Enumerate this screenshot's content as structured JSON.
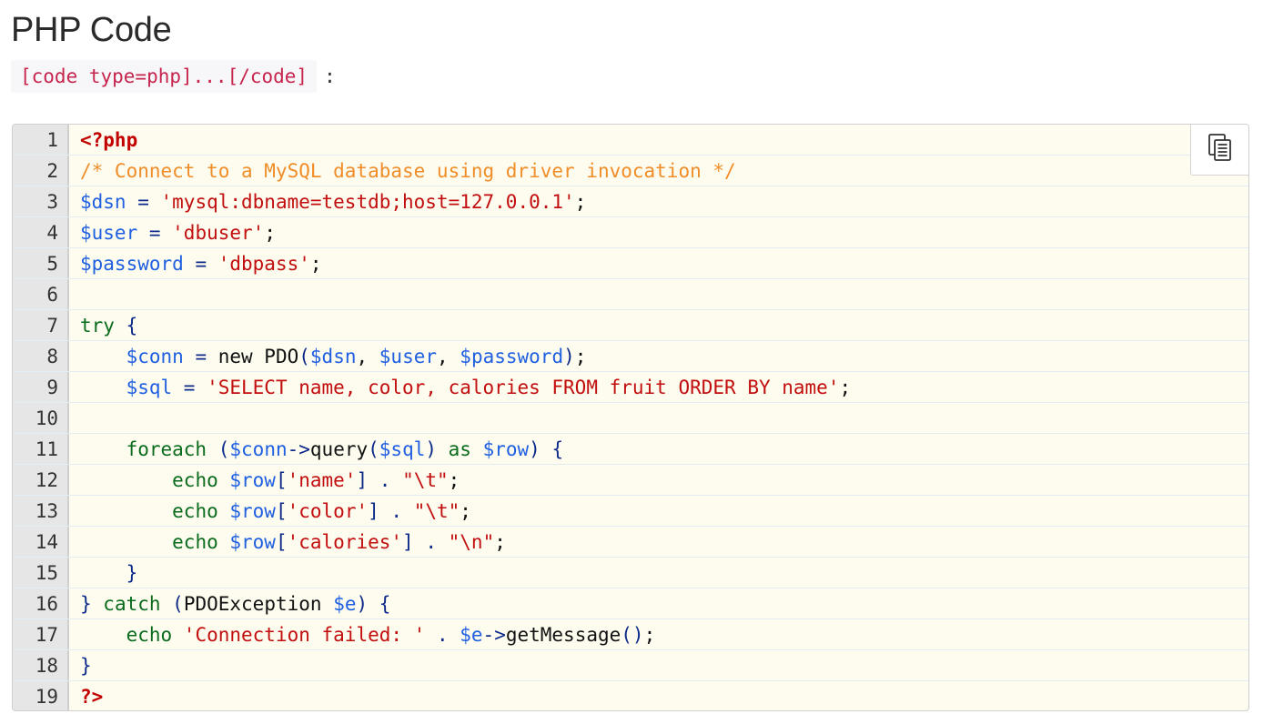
{
  "page": {
    "title": "PHP Code",
    "usage_code": "[code type=php]...[/code]",
    "usage_suffix": ":"
  },
  "copy_button": {
    "icon": "copy-icon"
  },
  "colors": {
    "background": "#fdfcef",
    "gutter": "#e6e6e6",
    "tag": "#c30000",
    "comment": "#f08d28",
    "variable": "#1f5fe0",
    "string": "#c20e0e",
    "keyword": "#0a6b1c",
    "operator": "#0d2a8a"
  },
  "code": {
    "language": "php",
    "lines": [
      {
        "n": "1",
        "tokens": [
          {
            "t": "tag",
            "v": "<?php"
          }
        ]
      },
      {
        "n": "2",
        "tokens": [
          {
            "t": "comment",
            "v": "/* Connect to a MySQL database using driver invocation */"
          }
        ]
      },
      {
        "n": "3",
        "tokens": [
          {
            "t": "var",
            "v": "$dsn"
          },
          {
            "t": "op",
            "v": " = "
          },
          {
            "t": "str",
            "v": "'mysql:dbname=testdb;host=127.0.0.1'"
          },
          {
            "t": "plain",
            "v": ";"
          }
        ]
      },
      {
        "n": "4",
        "tokens": [
          {
            "t": "var",
            "v": "$user"
          },
          {
            "t": "op",
            "v": " = "
          },
          {
            "t": "str",
            "v": "'dbuser'"
          },
          {
            "t": "plain",
            "v": ";"
          }
        ]
      },
      {
        "n": "5",
        "tokens": [
          {
            "t": "var",
            "v": "$password"
          },
          {
            "t": "op",
            "v": " = "
          },
          {
            "t": "str",
            "v": "'dbpass'"
          },
          {
            "t": "plain",
            "v": ";"
          }
        ]
      },
      {
        "n": "6",
        "tokens": []
      },
      {
        "n": "7",
        "tokens": [
          {
            "t": "kw",
            "v": "try"
          },
          {
            "t": "punc",
            "v": " {"
          }
        ]
      },
      {
        "n": "8",
        "tokens": [
          {
            "t": "plain",
            "v": "    "
          },
          {
            "t": "var",
            "v": "$conn"
          },
          {
            "t": "op",
            "v": " = "
          },
          {
            "t": "plain",
            "v": "new PDO"
          },
          {
            "t": "punc",
            "v": "("
          },
          {
            "t": "var",
            "v": "$dsn"
          },
          {
            "t": "plain",
            "v": ", "
          },
          {
            "t": "var",
            "v": "$user"
          },
          {
            "t": "plain",
            "v": ", "
          },
          {
            "t": "var",
            "v": "$password"
          },
          {
            "t": "punc",
            "v": ")"
          },
          {
            "t": "plain",
            "v": ";"
          }
        ]
      },
      {
        "n": "9",
        "tokens": [
          {
            "t": "plain",
            "v": "    "
          },
          {
            "t": "var",
            "v": "$sql"
          },
          {
            "t": "op",
            "v": " = "
          },
          {
            "t": "str",
            "v": "'SELECT name, color, calories FROM fruit ORDER BY name'"
          },
          {
            "t": "plain",
            "v": ";"
          }
        ]
      },
      {
        "n": "10",
        "tokens": []
      },
      {
        "n": "11",
        "tokens": [
          {
            "t": "plain",
            "v": "    "
          },
          {
            "t": "kw",
            "v": "foreach"
          },
          {
            "t": "punc",
            "v": " ("
          },
          {
            "t": "var",
            "v": "$conn"
          },
          {
            "t": "op",
            "v": "->"
          },
          {
            "t": "plain",
            "v": "query"
          },
          {
            "t": "punc",
            "v": "("
          },
          {
            "t": "var",
            "v": "$sql"
          },
          {
            "t": "punc",
            "v": ")"
          },
          {
            "t": "kw",
            "v": " as "
          },
          {
            "t": "var",
            "v": "$row"
          },
          {
            "t": "punc",
            "v": ") {"
          }
        ]
      },
      {
        "n": "12",
        "tokens": [
          {
            "t": "plain",
            "v": "        "
          },
          {
            "t": "kw",
            "v": "echo "
          },
          {
            "t": "var",
            "v": "$row"
          },
          {
            "t": "punc",
            "v": "["
          },
          {
            "t": "str",
            "v": "'name'"
          },
          {
            "t": "punc",
            "v": "]"
          },
          {
            "t": "op",
            "v": " . "
          },
          {
            "t": "str",
            "v": "\"\\t\""
          },
          {
            "t": "plain",
            "v": ";"
          }
        ]
      },
      {
        "n": "13",
        "tokens": [
          {
            "t": "plain",
            "v": "        "
          },
          {
            "t": "kw",
            "v": "echo "
          },
          {
            "t": "var",
            "v": "$row"
          },
          {
            "t": "punc",
            "v": "["
          },
          {
            "t": "str",
            "v": "'color'"
          },
          {
            "t": "punc",
            "v": "]"
          },
          {
            "t": "op",
            "v": " . "
          },
          {
            "t": "str",
            "v": "\"\\t\""
          },
          {
            "t": "plain",
            "v": ";"
          }
        ]
      },
      {
        "n": "14",
        "tokens": [
          {
            "t": "plain",
            "v": "        "
          },
          {
            "t": "kw",
            "v": "echo "
          },
          {
            "t": "var",
            "v": "$row"
          },
          {
            "t": "punc",
            "v": "["
          },
          {
            "t": "str",
            "v": "'calories'"
          },
          {
            "t": "punc",
            "v": "]"
          },
          {
            "t": "op",
            "v": " . "
          },
          {
            "t": "str",
            "v": "\"\\n\""
          },
          {
            "t": "plain",
            "v": ";"
          }
        ]
      },
      {
        "n": "15",
        "tokens": [
          {
            "t": "plain",
            "v": "    "
          },
          {
            "t": "punc",
            "v": "}"
          }
        ]
      },
      {
        "n": "16",
        "tokens": [
          {
            "t": "punc",
            "v": "}"
          },
          {
            "t": "kw",
            "v": " catch "
          },
          {
            "t": "punc",
            "v": "("
          },
          {
            "t": "plain",
            "v": "PDOException "
          },
          {
            "t": "var",
            "v": "$e"
          },
          {
            "t": "punc",
            "v": ") {"
          }
        ]
      },
      {
        "n": "17",
        "tokens": [
          {
            "t": "plain",
            "v": "    "
          },
          {
            "t": "kw",
            "v": "echo "
          },
          {
            "t": "str",
            "v": "'Connection failed: '"
          },
          {
            "t": "op",
            "v": " . "
          },
          {
            "t": "var",
            "v": "$e"
          },
          {
            "t": "op",
            "v": "->"
          },
          {
            "t": "plain",
            "v": "getMessage"
          },
          {
            "t": "punc",
            "v": "()"
          },
          {
            "t": "plain",
            "v": ";"
          }
        ]
      },
      {
        "n": "18",
        "tokens": [
          {
            "t": "punc",
            "v": "}"
          }
        ]
      },
      {
        "n": "19",
        "tokens": [
          {
            "t": "tag",
            "v": "?>"
          }
        ]
      }
    ]
  }
}
